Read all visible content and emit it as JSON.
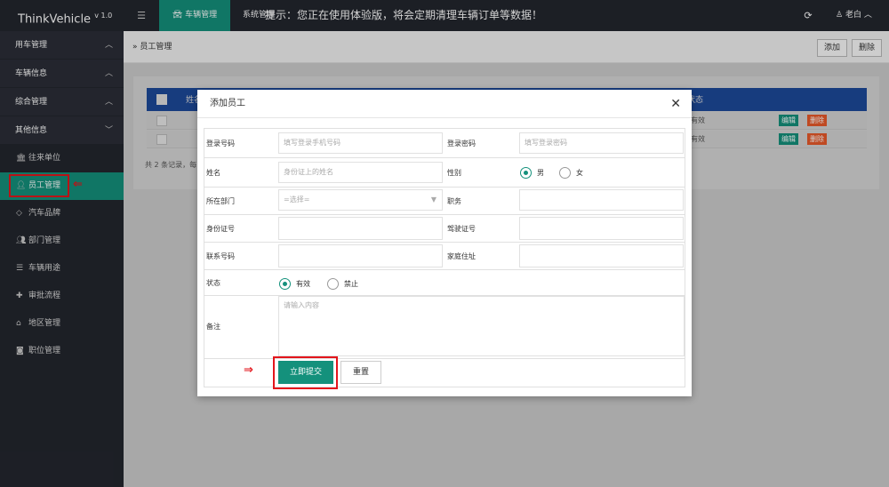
{
  "app": {
    "name": "ThinkVehicle",
    "version": "v 1.0"
  },
  "topbar": {
    "vehicle_tab": "车辆管理",
    "system_tab": "系统管理",
    "notice": "提示：您正在使用体验版，将会定期清理车辆订单等数据！",
    "user": "老白"
  },
  "sidebar": {
    "groups": [
      {
        "label": "用车管理",
        "expanded": true
      },
      {
        "label": "车辆信息",
        "expanded": true
      },
      {
        "label": "综合管理",
        "expanded": true
      },
      {
        "label": "其他信息",
        "expanded": false
      }
    ],
    "items": [
      {
        "label": "往来单位",
        "icon": "bank-icon"
      },
      {
        "label": "员工管理",
        "icon": "user-icon",
        "active": true
      },
      {
        "label": "汽车品牌",
        "icon": "diamond-icon"
      },
      {
        "label": "部门管理",
        "icon": "users-icon"
      },
      {
        "label": "车辆用途",
        "icon": "list-icon"
      },
      {
        "label": "审批流程",
        "icon": "puzzle-icon"
      },
      {
        "label": "地区管理",
        "icon": "home-icon"
      },
      {
        "label": "职位管理",
        "icon": "camera-icon"
      }
    ]
  },
  "main": {
    "breadcrumb": "员工管理",
    "add_label": "添加",
    "delete_label": "删除",
    "table": {
      "header_fragments": [
        "姓名",
        "状态"
      ],
      "rows": [
        {
          "status": "有效",
          "edit": "编辑",
          "delete": "删除"
        },
        {
          "status": "有效",
          "edit": "编辑",
          "delete": "删除"
        }
      ],
      "summary": "共 2 条记录，每"
    }
  },
  "modal": {
    "title": "添加员工",
    "fields": {
      "login_phone": {
        "label": "登录号码",
        "placeholder": "填写登录手机号码"
      },
      "login_password": {
        "label": "登录密码",
        "placeholder": "填写登录密码"
      },
      "name": {
        "label": "姓名",
        "placeholder": "身份证上的姓名"
      },
      "gender": {
        "label": "性别",
        "options": [
          "男",
          "女"
        ],
        "selected": "男"
      },
      "department": {
        "label": "所在部门",
        "placeholder": "=选择="
      },
      "position": {
        "label": "职务"
      },
      "id_number": {
        "label": "身份证号"
      },
      "license_number": {
        "label": "驾驶证号"
      },
      "phone": {
        "label": "联系号码"
      },
      "address": {
        "label": "家庭住址"
      },
      "status": {
        "label": "状态",
        "options": [
          "有效",
          "禁止"
        ],
        "selected": "有效"
      },
      "remark": {
        "label": "备注",
        "placeholder": "请输入内容"
      }
    },
    "submit_label": "立即提交",
    "reset_label": "重置"
  },
  "colors": {
    "accent": "#14917c",
    "dark": "#23262e",
    "table_header": "#1d4a9a",
    "highlight": "#e3161c",
    "danger": "#e95a2a"
  }
}
